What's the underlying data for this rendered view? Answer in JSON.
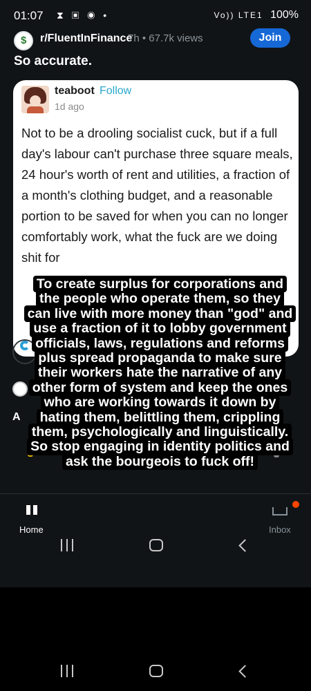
{
  "status_bar": {
    "time": "01:07",
    "notification_icons": "⧗ ▣ ◉ •",
    "signal_label": "Vo)) LTE1",
    "battery": "100%"
  },
  "post": {
    "subreddit": "r/FluentInFinance",
    "meta": "7h • 67.7k views",
    "join_label": "Join",
    "title": "So accurate."
  },
  "tweet": {
    "author": "teaboot",
    "follow_label": "Follow",
    "time": "1d ago",
    "body": "Not to be a drooling socialist cuck, but if a full day's labour can't purchase three square meals, 24 hour's worth of rent and utilities, a fraction of a month's clothing budget, and a reasonable portion to be saved for when you can no longer comfortably work, what the fuck are we doing shit for"
  },
  "overlay_caption": [
    "To create surplus for corporations and",
    "the people who operate them, so they",
    "can live with more money than \"god\" and",
    "use a fraction of it to lobby government",
    "officials, laws, regulations and reforms",
    "plus spread propaganda to make sure",
    "their workers hate the narrative of any",
    "other form of system and keep the ones",
    "who are working towards it down by",
    "hating them, belittling them, crippling",
    "them, psychologically and linguistically.",
    "So stop engaging in identity politics and",
    "ask the bourgeois to fuck off!"
  ],
  "partial": {
    "letter": "A"
  },
  "bottom_nav": {
    "home_label": "Home",
    "inbox_label": "Inbox"
  },
  "colors": {
    "app_background": "#111417",
    "join_button": "#1668d6",
    "follow_link": "#2aa7ca",
    "reddit_orange": "#ff4500"
  }
}
